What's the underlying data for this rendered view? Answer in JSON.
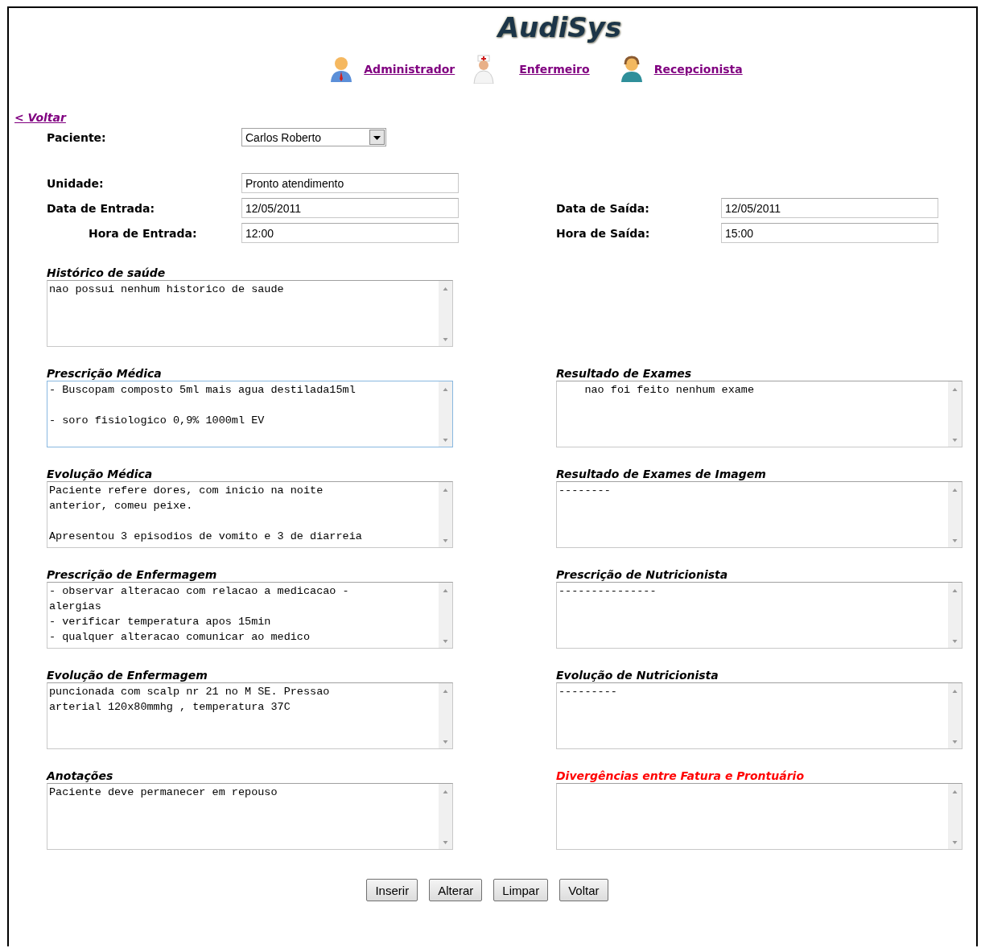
{
  "logo": "AudiSys",
  "nav": [
    {
      "label": "Administrador",
      "kind": "admin"
    },
    {
      "label": "Enfermeiro",
      "kind": "nurse"
    },
    {
      "label": "Recepcionista",
      "kind": "receptionist"
    }
  ],
  "back_link": "< Voltar",
  "patient": {
    "label": "Paciente:",
    "value": "Carlos Roberto"
  },
  "unit": {
    "label": "Unidade:",
    "value": "Pronto atendimento"
  },
  "dates": [
    {
      "left": {
        "label": "Data de Entrada:",
        "value": "12/05/2011",
        "indented": false
      },
      "right": {
        "label": "Data de Saída:",
        "value": "12/05/2011"
      }
    },
    {
      "left": {
        "label": "Hora de Entrada:",
        "value": "12:00",
        "indented": true
      },
      "right": {
        "label": "Hora de Saída:",
        "value": "15:00"
      }
    }
  ],
  "note_rows": [
    {
      "left": {
        "label": "Histórico de saúde",
        "text": "nao possui nenhum historico de saude",
        "focused": false,
        "alert": false
      }
    },
    {
      "left": {
        "label": "Prescrição Médica",
        "text": "- Buscopam composto 5ml mais agua destilada15ml\n\n- soro fisiologico 0,9% 1000ml EV",
        "focused": true,
        "alert": false
      },
      "right": {
        "label": "Resultado de Exames",
        "text": "    nao foi feito nenhum exame",
        "focused": false,
        "alert": false
      }
    },
    {
      "left": {
        "label": "Evolução Médica",
        "text": "Paciente refere dores, com inicio na noite\nanterior, comeu peixe.\n\nApresentou 3 episodios de vomito e 3 de diarreia",
        "focused": false,
        "alert": false
      },
      "right": {
        "label": "Resultado de Exames de Imagem",
        "text": "--------",
        "focused": false,
        "alert": false
      }
    },
    {
      "left": {
        "label": "Prescrição de Enfermagem",
        "text": "- observar alteracao com relacao a medicacao -\nalergias\n- verificar temperatura apos 15min\n- qualquer alteracao comunicar ao medico",
        "focused": false,
        "alert": false
      },
      "right": {
        "label": "Prescrição de Nutricionista",
        "text": "---------------",
        "focused": false,
        "alert": false
      }
    },
    {
      "left": {
        "label": "Evolução de Enfermagem",
        "text": "puncionada com scalp nr 21 no M SE. Pressao\narterial 120x80mmhg , temperatura 37C",
        "focused": false,
        "alert": false
      },
      "right": {
        "label": "Evolução de Nutricionista",
        "text": "---------",
        "focused": false,
        "alert": false
      }
    },
    {
      "left": {
        "label": "Anotações",
        "text": "Paciente deve permanecer em repouso",
        "focused": false,
        "alert": false
      },
      "right": {
        "label": "Divergências entre Fatura e Prontuário",
        "focused": false,
        "alert": true
      }
    }
  ],
  "buttons": [
    "Inserir",
    "Alterar",
    "Limpar",
    "Voltar"
  ]
}
